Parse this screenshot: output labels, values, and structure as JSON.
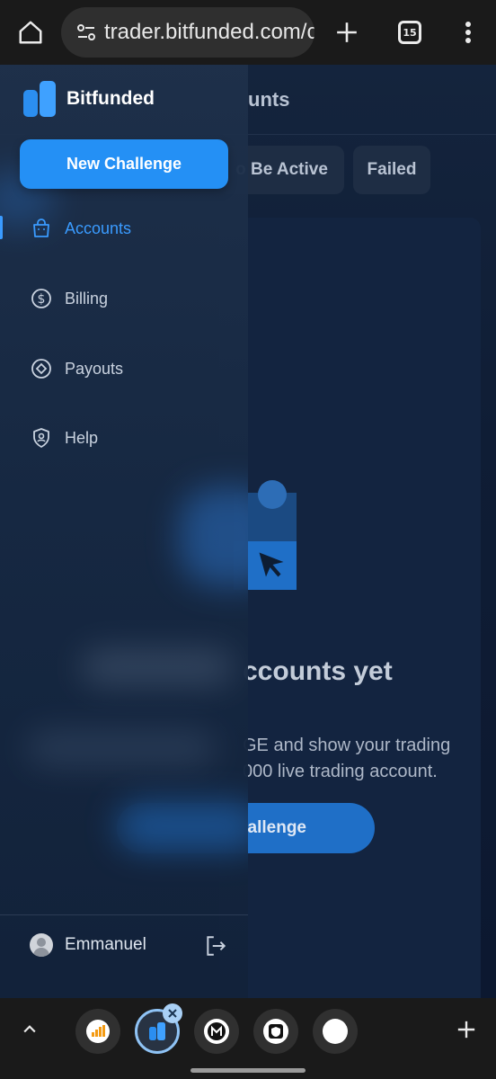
{
  "browser": {
    "url": "trader.bitfunded.com/c",
    "tab_count": "15",
    "icons": [
      "home-icon",
      "site-settings-icon",
      "new-tab-icon",
      "tab-switcher-icon",
      "more-menu-icon"
    ]
  },
  "page": {
    "header_title": "unts",
    "filters": [
      "o Be Active",
      "Failed"
    ],
    "empty_title": "ccounts yet",
    "empty_desc_line1": "GE and show your trading",
    "empty_desc_line2": "000 live trading account.",
    "cta_label": "allenge"
  },
  "drawer": {
    "brand": "Bitfunded",
    "new_challenge_label": "New Challenge",
    "nav": [
      {
        "label": "Accounts",
        "icon": "bag-icon",
        "active": true
      },
      {
        "label": "Billing",
        "icon": "dollar-circle-icon",
        "active": false
      },
      {
        "label": "Payouts",
        "icon": "diamond-circle-icon",
        "active": false
      },
      {
        "label": "Help",
        "icon": "shield-face-icon",
        "active": false
      }
    ],
    "user_name": "Emmanuel",
    "accent_color": "#3a9bff"
  },
  "tabstrip": {
    "icons": [
      "chevron-up-icon",
      "tab-orange-icon",
      "tab-bitfunded-icon",
      "tab-close-icon",
      "tab-m-icon",
      "tab-shield-icon",
      "tab-blank-icon",
      "add-tab-icon"
    ]
  }
}
